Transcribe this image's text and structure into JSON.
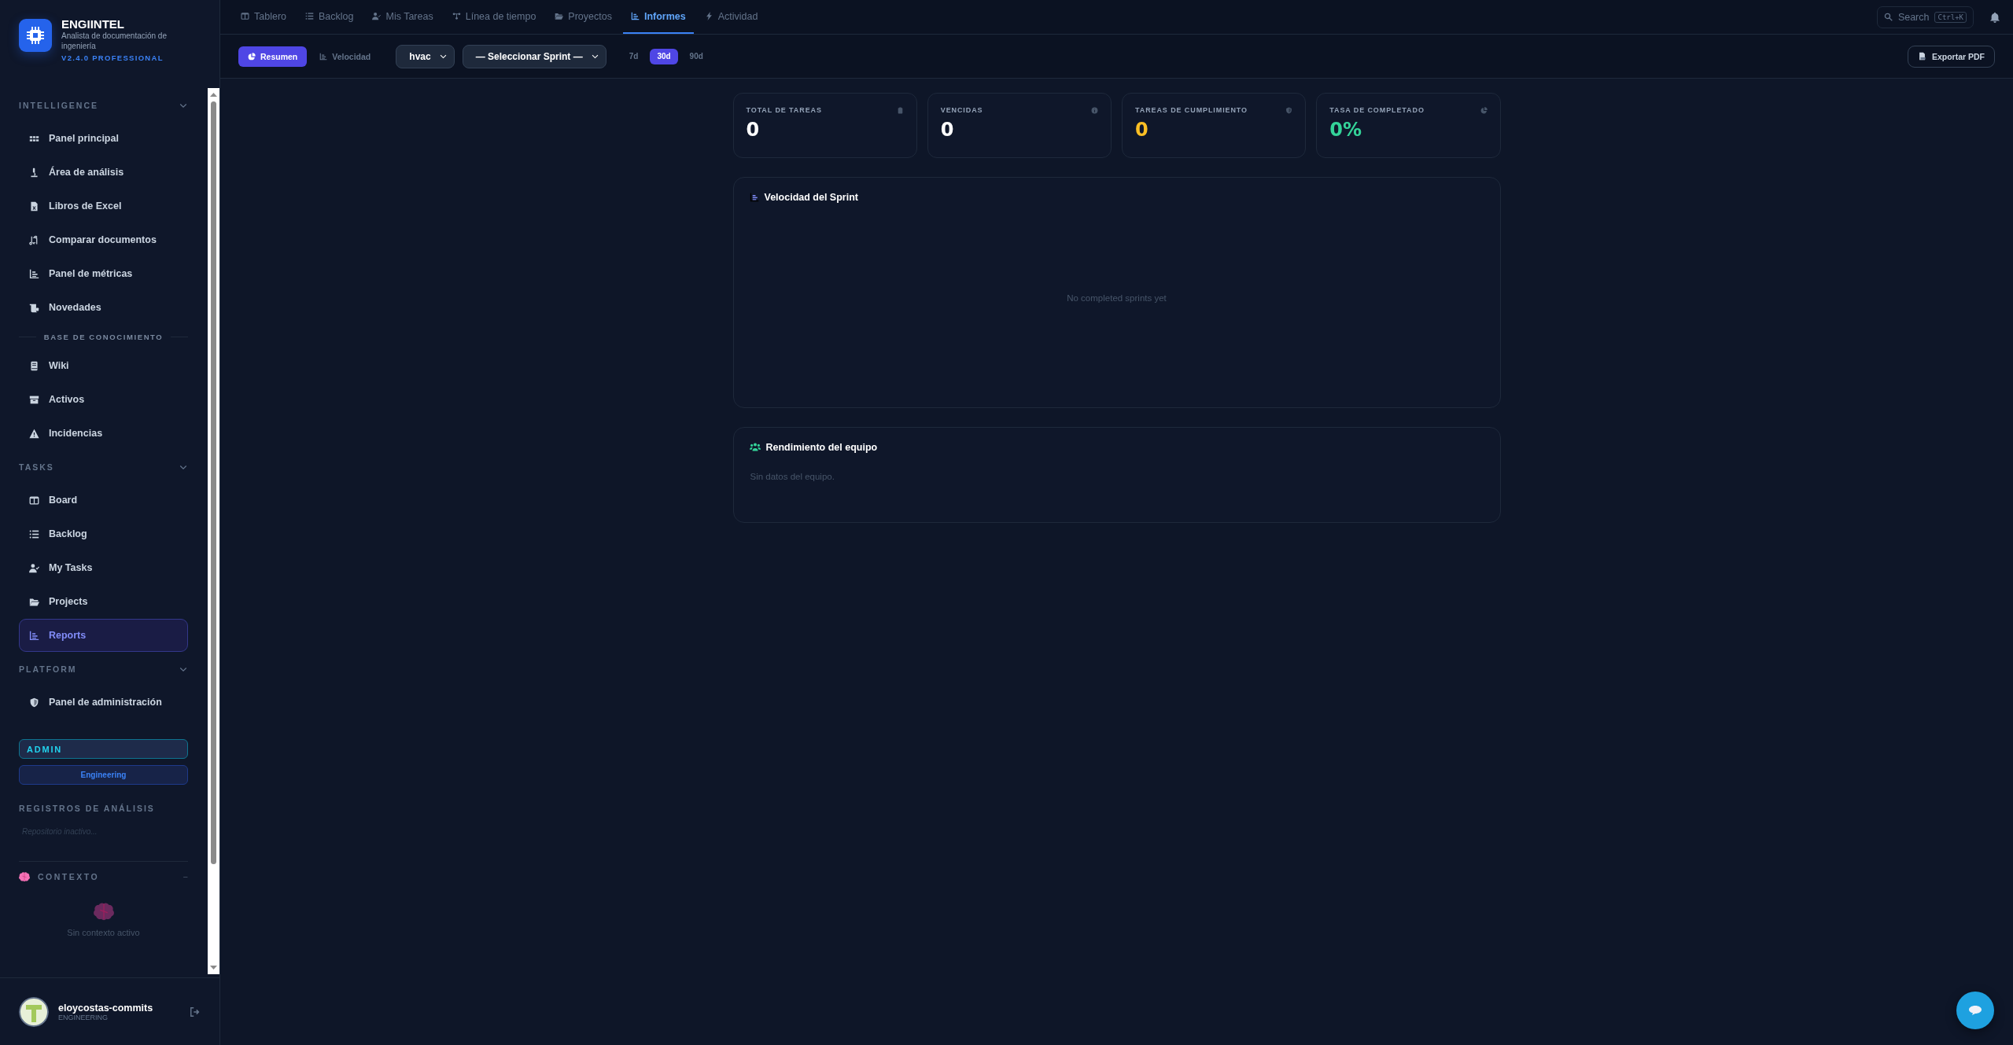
{
  "brand": {
    "name": "ENGIINTEL",
    "subtitle": "Analista de documentación de ingeniería",
    "version": "V2.4.0 PROFESSIONAL"
  },
  "sidebar": {
    "sections": [
      {
        "title": "INTELLIGENCE",
        "expanded": true,
        "items": [
          {
            "kind": "link",
            "label": "Panel principal",
            "selected": false
          },
          {
            "kind": "link",
            "label": "Área de análisis",
            "selected": false
          },
          {
            "kind": "link",
            "label": "Libros de Excel",
            "selected": false
          },
          {
            "kind": "link",
            "label": "Comparar documentos",
            "selected": false
          },
          {
            "kind": "link",
            "label": "Panel de métricas",
            "selected": false
          },
          {
            "kind": "link",
            "label": "Novedades",
            "selected": false
          },
          {
            "kind": "heading",
            "label": "BASE DE CONOCIMIENTO"
          },
          {
            "kind": "link",
            "label": "Wiki",
            "selected": false
          },
          {
            "kind": "link",
            "label": "Activos",
            "selected": false
          },
          {
            "kind": "link",
            "label": "Incidencias",
            "selected": false
          }
        ]
      },
      {
        "title": "TASKS",
        "expanded": true,
        "items": [
          {
            "kind": "link",
            "label": "Board",
            "selected": false
          },
          {
            "kind": "link",
            "label": "Backlog",
            "selected": false
          },
          {
            "kind": "link",
            "label": "My Tasks",
            "selected": false
          },
          {
            "kind": "link",
            "label": "Projects",
            "selected": false
          },
          {
            "kind": "link",
            "label": "Reports",
            "selected": true
          }
        ]
      },
      {
        "title": "PLATFORM",
        "expanded": true,
        "items": [
          {
            "kind": "link",
            "label": "Panel de administración",
            "selected": false
          }
        ]
      }
    ],
    "role_badge": "ADMIN",
    "team_badge": "Engineering",
    "logs": {
      "title": "REGISTROS DE ANÁLISIS",
      "empty_text": "Repositorio inactivo..."
    },
    "context": {
      "title": "CONTEXTO",
      "collapse_symbol": "−",
      "empty_text": "Sin contexto activo"
    },
    "user": {
      "name": "eloycostas-commits",
      "team": "ENGINEERING"
    }
  },
  "topnav": {
    "tabs": [
      {
        "label": "Tablero",
        "selected": false
      },
      {
        "label": "Backlog",
        "selected": false
      },
      {
        "label": "Mis Tareas",
        "selected": false
      },
      {
        "label": "Línea de tiempo",
        "selected": false
      },
      {
        "label": "Proyectos",
        "selected": false
      },
      {
        "label": "Informes",
        "selected": true
      },
      {
        "label": "Actividad",
        "selected": false
      }
    ],
    "search": {
      "placeholder": "Search",
      "shortcut": "Ctrl+K"
    }
  },
  "toolbar": {
    "views": [
      {
        "label": "Resumen",
        "selected": true
      },
      {
        "label": "Velocidad",
        "selected": false
      }
    ],
    "project_select": "hvac",
    "sprint_select": "— Seleccionar Sprint —",
    "ranges": [
      {
        "label": "7d",
        "selected": false
      },
      {
        "label": "30d",
        "selected": true
      },
      {
        "label": "90d",
        "selected": false
      }
    ],
    "export_button": "Exportar PDF"
  },
  "stats": [
    {
      "label": "TOTAL DE TAREAS",
      "value": "0",
      "color": "#ffffff"
    },
    {
      "label": "VENCIDAS",
      "value": "0",
      "color": "#ffffff"
    },
    {
      "label": "TAREAS DE CUMPLIMIENTO",
      "value": "0",
      "color": "#fbbf24"
    },
    {
      "label": "TASA DE COMPLETADO",
      "value": "0%",
      "color": "#34d399"
    }
  ],
  "velocity_panel": {
    "title": "Velocidad del Sprint",
    "empty_text": "No completed sprints yet"
  },
  "team_panel": {
    "title": "Rendimiento del equipo",
    "empty_text": "Sin datos del equipo."
  }
}
